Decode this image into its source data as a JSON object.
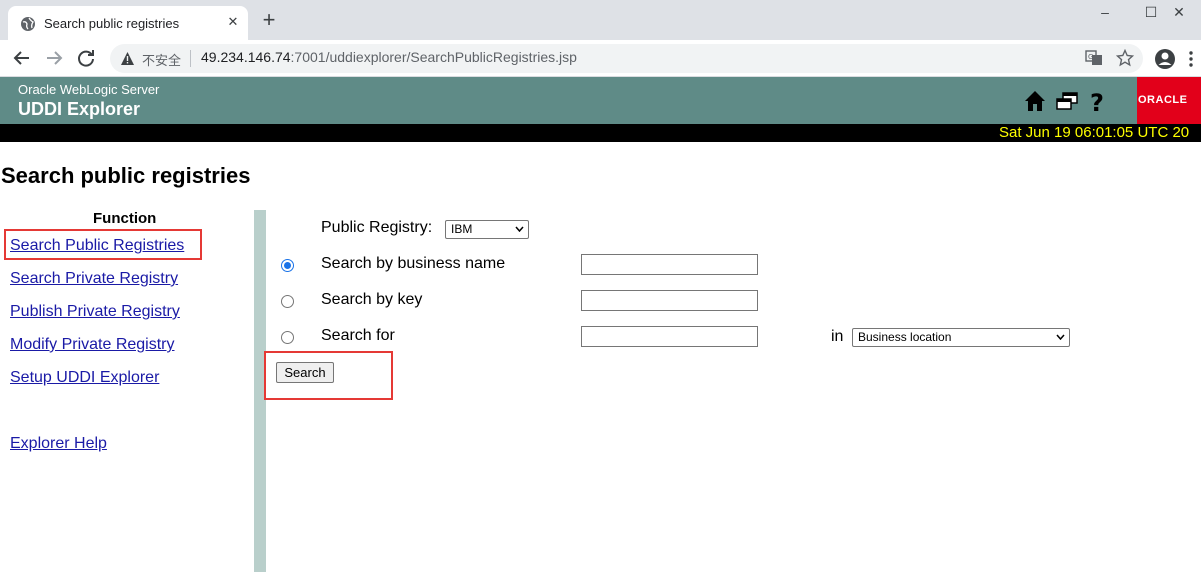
{
  "browser": {
    "tab_title": "Search public registries",
    "new_tab": "+",
    "security_label": "不安全",
    "url_host": "49.234.146.74",
    "url_rest": ":7001/uddiexplorer/SearchPublicRegistries.jsp",
    "window_minimize": "–",
    "window_maximize": "☐",
    "window_close": "✕"
  },
  "header": {
    "subtitle": "Oracle WebLogic Server",
    "title": "UDDI Explorer",
    "logo_text": "ORACLE",
    "datetime": "Sat Jun 19 06:01:05 UTC 20"
  },
  "page": {
    "heading": "Search public registries"
  },
  "functions": {
    "heading": "Function",
    "items": [
      {
        "label": "Search Public Registries"
      },
      {
        "label": "Search Private Registry"
      },
      {
        "label": "Publish Private Registry"
      },
      {
        "label": "Modify Private Registry"
      },
      {
        "label": "Setup UDDI Explorer"
      },
      {
        "label": "Explorer Help"
      }
    ]
  },
  "form": {
    "registry_label": "Public Registry:",
    "registry_value": "IBM",
    "option_business_name": "Search by business name",
    "option_key": "Search by key",
    "option_search_for": "Search for",
    "in_label": "in",
    "in_value": "Business location",
    "selected_option": "Search by business name",
    "search_button": "Search"
  },
  "colors": {
    "header_bg": "#5f8b87",
    "date_text": "#ffff00",
    "link": "#1a1aa6",
    "highlight": "#e53935",
    "oracle_red": "#e2001a"
  }
}
